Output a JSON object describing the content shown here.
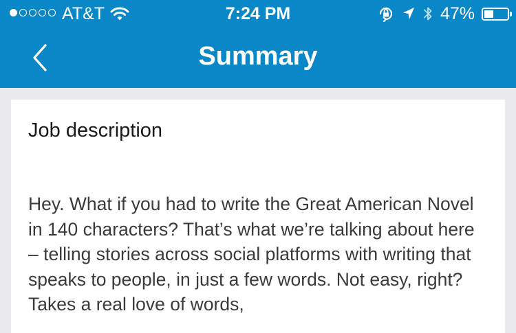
{
  "status_bar": {
    "signal_bars_filled": 1,
    "signal_bars_total": 5,
    "carrier": "AT&T",
    "wifi_icon": "wifi-icon",
    "time": "7:24 PM",
    "orientation_lock_icon": "orientation-lock-icon",
    "location_icon": "location-arrow-icon",
    "bluetooth_icon": "bluetooth-icon",
    "battery_percent": "47%",
    "battery_level": 0.47
  },
  "nav": {
    "back_icon": "chevron-left-icon",
    "title": "Summary"
  },
  "card": {
    "heading": "Job description",
    "body": "Hey. What if you had to write the Great American Novel in 140 characters? That’s what we’re talking about here – telling stories across social platforms with writing that speaks to people, in just a few words. Not easy, right? Takes a real love of words,"
  },
  "colors": {
    "header_background": "#0a87c7",
    "page_background": "#e9e9ee",
    "card_background": "#ffffff",
    "header_text": "#ffffff",
    "heading_text": "#1a1a1a",
    "body_text": "#3a3a3a"
  }
}
